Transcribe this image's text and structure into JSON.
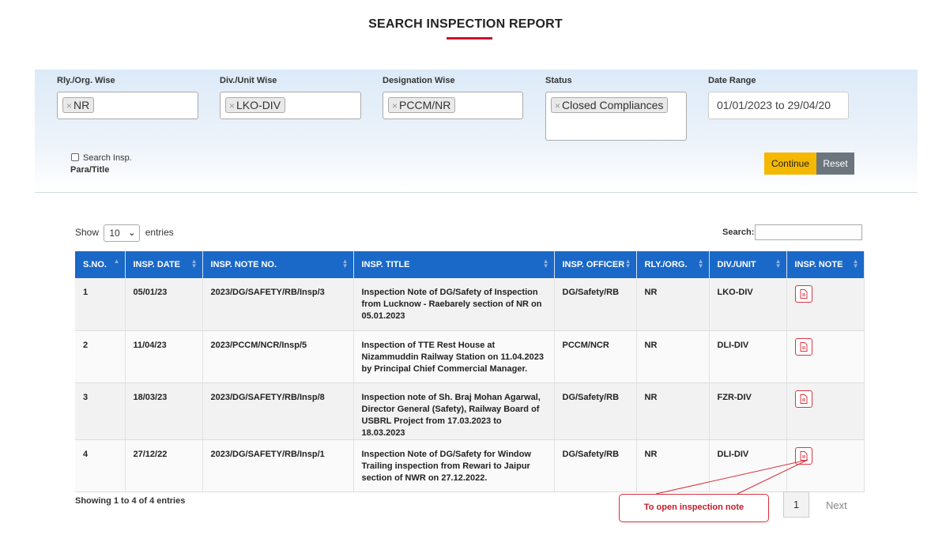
{
  "page": {
    "title": "SEARCH INSPECTION REPORT"
  },
  "filters": {
    "rly": {
      "label": "Rly./Org. Wise",
      "chip": "NR"
    },
    "div": {
      "label": "Div./Unit Wise",
      "chip": "LKO-DIV"
    },
    "designation": {
      "label": "Designation Wise",
      "chip": "PCCM/NR"
    },
    "status": {
      "label": "Status",
      "chip": "Closed Compliances"
    },
    "date": {
      "label": "Date Range",
      "value": "01/01/2023 to 29/04/20"
    },
    "chip_remove": "×",
    "search_para_line1": "Search Insp.",
    "search_para_line2": "Para/Title",
    "continue_label": "Continue",
    "reset_label": "Reset"
  },
  "table_controls": {
    "show_label": "Show",
    "entries_value": "10",
    "entries_label": "entries",
    "search_label": "Search:"
  },
  "table": {
    "headers": [
      "S.NO.",
      "INSP. DATE",
      "INSP. NOTE NO.",
      "INSP. TITLE",
      "INSP. OFFICER",
      "RLY./ORG.",
      "DIV./UNIT",
      "INSP. NOTE"
    ],
    "rows": [
      {
        "sno": "1",
        "date": "05/01/23",
        "note_no": "2023/DG/SAFETY/RB/Insp/3",
        "title": "Inspection Note of DG/Safety of Inspection from Lucknow - Raebarely section of NR on 05.01.2023",
        "officer": "DG/Safety/RB",
        "rly": "NR",
        "div": "LKO-DIV"
      },
      {
        "sno": "2",
        "date": "11/04/23",
        "note_no": "2023/PCCM/NCR/Insp/5",
        "title": "Inspection of TTE Rest House at Nizammuddin Railway Station on 11.04.2023 by Principal Chief Commercial Manager.",
        "officer": "PCCM/NCR",
        "rly": "NR",
        "div": "DLI-DIV"
      },
      {
        "sno": "3",
        "date": "18/03/23",
        "note_no": "2023/DG/SAFETY/RB/Insp/8",
        "title": "Inspection note of Sh. Braj Mohan Agarwal, Director General (Safety), Railway Board of USBRL Project from 17.03.2023 to 18.03.2023",
        "officer": "DG/Safety/RB",
        "rly": "NR",
        "div": "FZR-DIV"
      },
      {
        "sno": "4",
        "date": "27/12/22",
        "note_no": "2023/DG/SAFETY/RB/Insp/1",
        "title": "Inspection Note of DG/Safety for Window Trailing inspection from Rewari to Jaipur section of NWR on 27.12.2022.",
        "officer": "DG/Safety/RB",
        "rly": "NR",
        "div": "DLI-DIV"
      }
    ]
  },
  "footer": {
    "showing": "Showing 1 to 4 of 4 entries",
    "page": "1",
    "next": "Next"
  },
  "callout": {
    "text": "To open inspection note"
  },
  "colors": {
    "header_blue": "#1a68c8",
    "continue_yellow": "#f5b800",
    "reset_gray": "#6c757d",
    "accent_red": "#c8102e"
  }
}
